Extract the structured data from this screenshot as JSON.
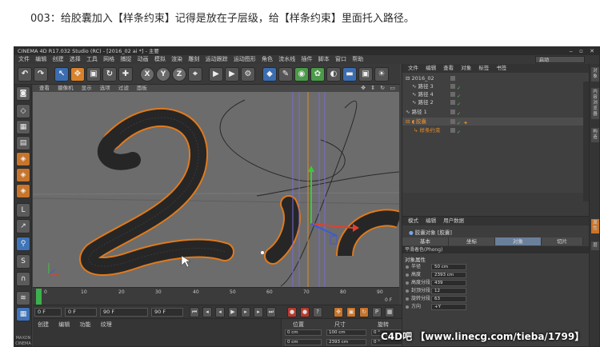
{
  "caption": "003：给胶囊加入【样条约束】记得是放在子层级，给【样条约束】里面托入路径。",
  "window": {
    "title": "CINEMA 4D R17.032 Studio (RC) - [2016_02 ai *] - 主要",
    "layout_label": "启动"
  },
  "menubar": [
    "文件",
    "编辑",
    "创建",
    "选择",
    "工具",
    "网格",
    "捕捉",
    "动画",
    "模拟",
    "渲染",
    "雕刻",
    "运动跟踪",
    "运动图形",
    "角色",
    "流水线",
    "插件",
    "脚本",
    "窗口",
    "帮助"
  ],
  "viewport": {
    "menu": [
      "查看",
      "摄像机",
      "显示",
      "选项",
      "过滤",
      "面板"
    ],
    "label": "透视视图"
  },
  "timeline": {
    "ticks": [
      "0",
      "10",
      "20",
      "30",
      "40",
      "50",
      "60",
      "70",
      "80",
      "90"
    ],
    "frame_label": "0 F"
  },
  "playback": {
    "start": "0 F",
    "min": "0 F",
    "max": "90 F",
    "end": "90 F"
  },
  "bottom_menu": [
    "创建",
    "编辑",
    "功能",
    "纹理"
  ],
  "coordinates": {
    "headers": [
      "位置",
      "尺寸",
      "旋转"
    ],
    "rows": [
      {
        "pos": "0 cm",
        "size": "100 cm",
        "rot": "0 °"
      },
      {
        "pos": "0 cm",
        "size": "2393 cm",
        "rot": "0 °"
      }
    ]
  },
  "object_manager": {
    "menu": [
      "文件",
      "编辑",
      "查看",
      "对象",
      "标签",
      "书签"
    ],
    "items": [
      {
        "name": "2016_02",
        "indent": 0,
        "selected": false
      },
      {
        "name": "路径 3",
        "indent": 1,
        "selected": false
      },
      {
        "name": "路径 4",
        "indent": 1,
        "selected": false
      },
      {
        "name": "路径 2",
        "indent": 1,
        "selected": false
      },
      {
        "name": "路径 1",
        "indent": 0,
        "selected": false
      },
      {
        "name": "胶囊",
        "indent": 0,
        "selected": true
      },
      {
        "name": "样条约束",
        "indent": 1,
        "selected": false
      }
    ]
  },
  "attribute_manager": {
    "menu": [
      "模式",
      "编辑",
      "用户数据"
    ],
    "title": "胶囊对象 [胶囊]",
    "tabs": [
      "基本",
      "坐标",
      "对象",
      "切片"
    ],
    "active_tab": "对象",
    "subheader": "平滑着色(Phong)",
    "section": "对象属性",
    "params": [
      {
        "label": "半径",
        "value": "50 cm"
      },
      {
        "label": "高度",
        "value": "2393 cm"
      },
      {
        "label": "高度分段",
        "value": "439"
      },
      {
        "label": "封顶分段",
        "value": "12"
      },
      {
        "label": "旋转分段",
        "value": "63"
      },
      {
        "label": "方向",
        "value": "+Y"
      }
    ]
  },
  "right_tabs": [
    "对象",
    "内容浏览器",
    "构造",
    "属性",
    "层"
  ],
  "left_brand": "MAXON CINEMA 4D",
  "watermark": "C4D吧 【www.linecg.com/tieba/1799】",
  "colors": {
    "accent_orange": "#d9822b",
    "accent_blue": "#3b6db1",
    "ui_bg": "#3f3f3f",
    "viewport_bg": "#6c6c6c"
  }
}
